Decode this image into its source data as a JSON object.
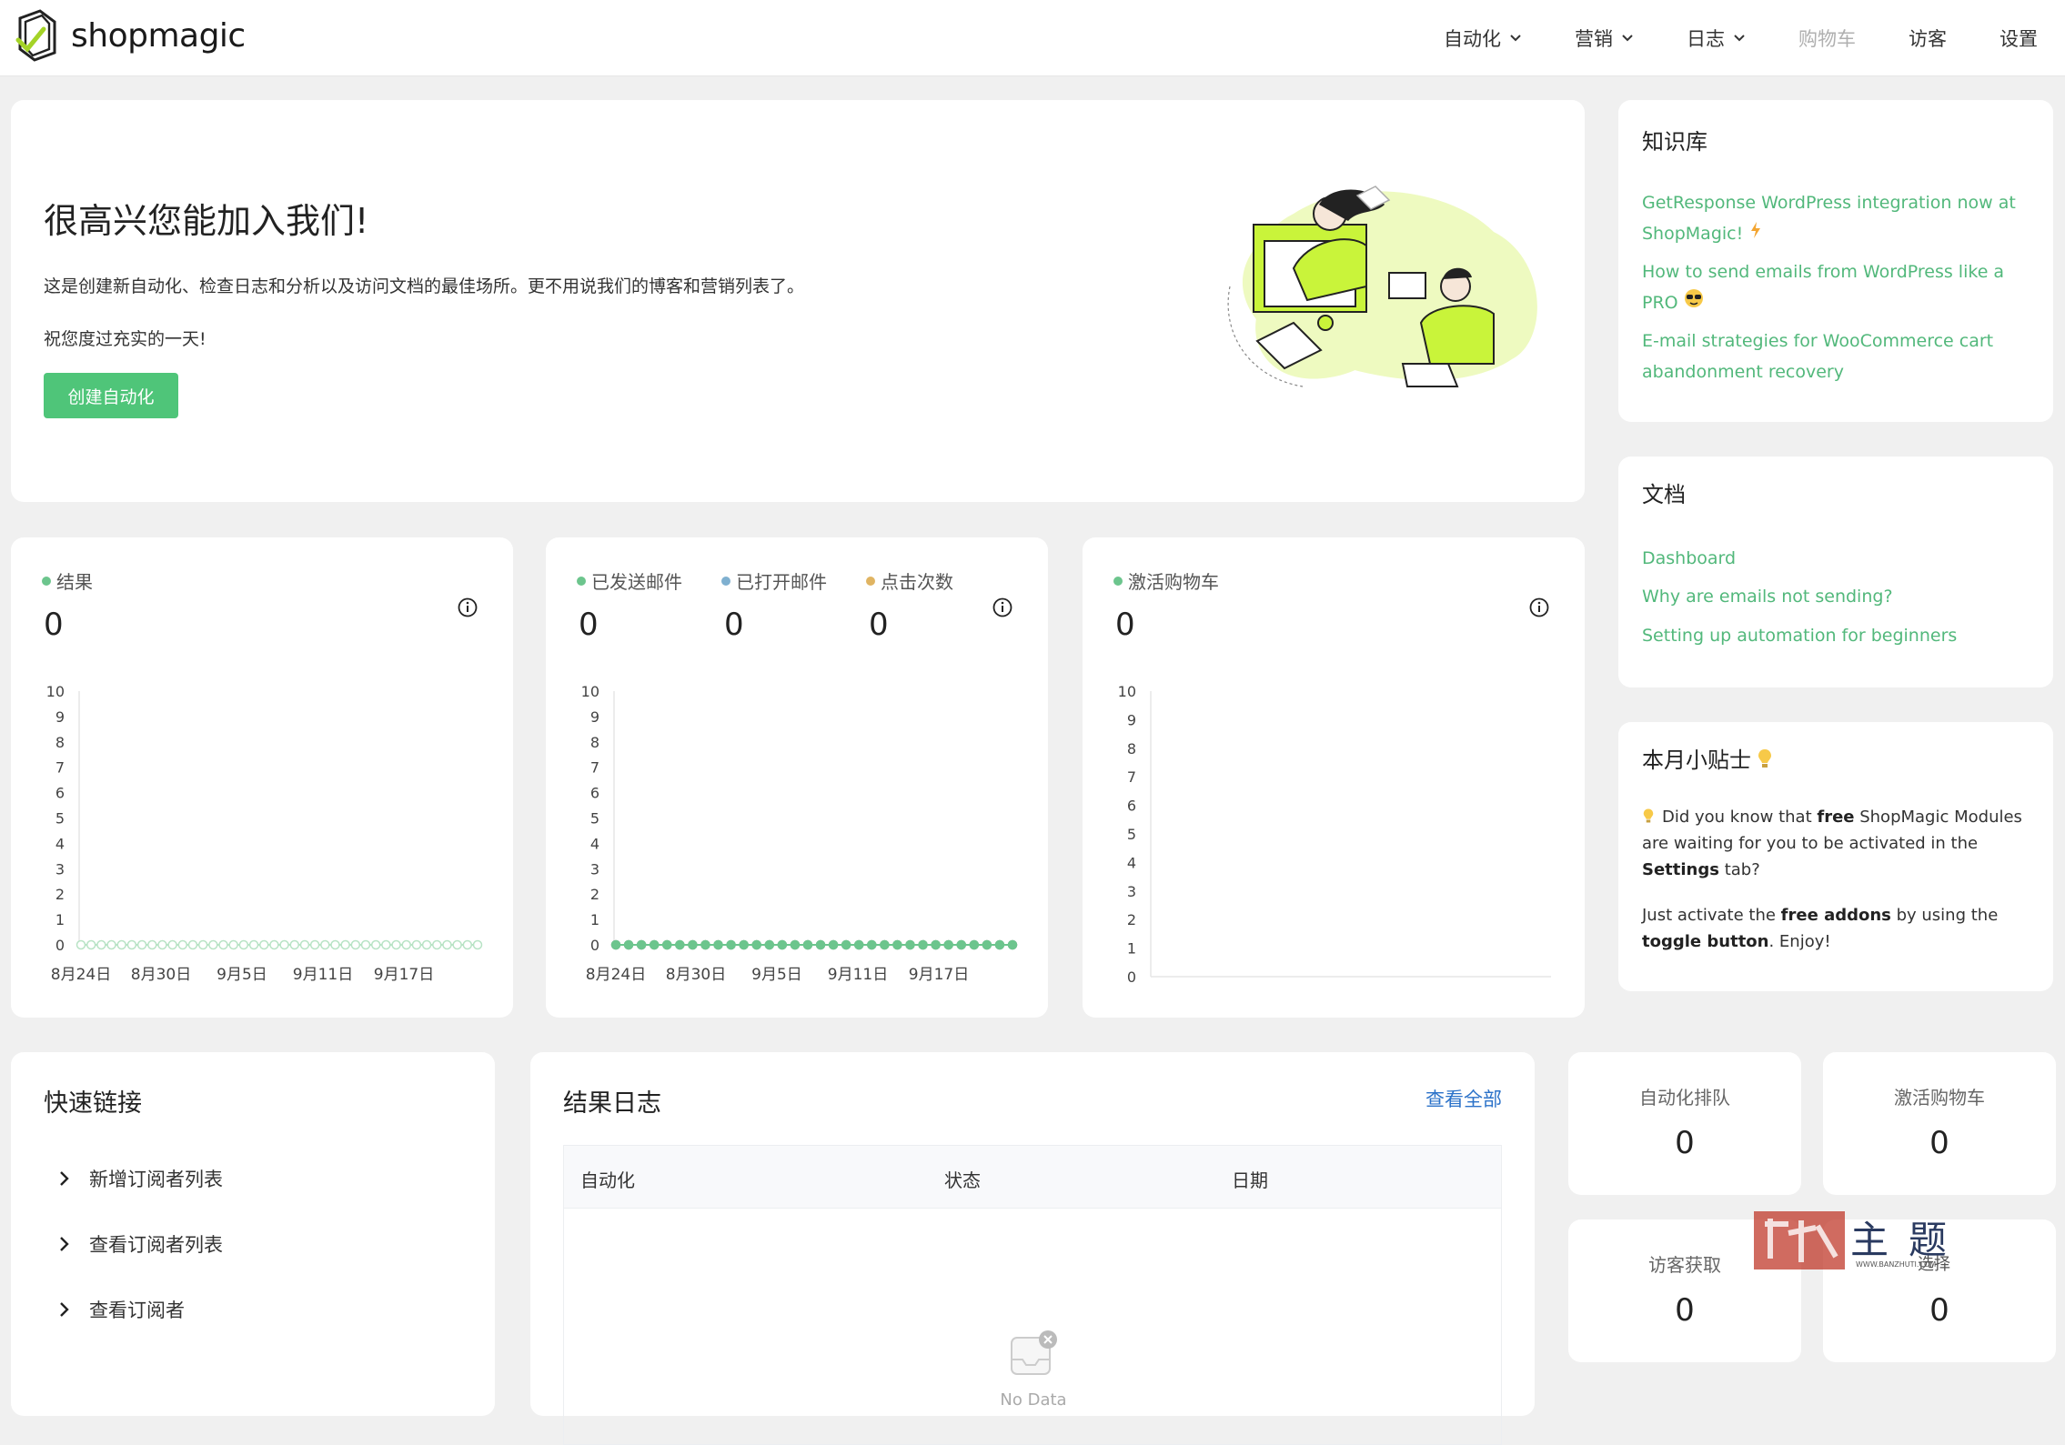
{
  "app": {
    "logo_text": "shopmagic"
  },
  "nav": [
    {
      "label": "自动化",
      "has_dropdown": true,
      "disabled": false
    },
    {
      "label": "营销",
      "has_dropdown": true,
      "disabled": false
    },
    {
      "label": "日志",
      "has_dropdown": true,
      "disabled": false
    },
    {
      "label": "购物车",
      "has_dropdown": false,
      "disabled": true
    },
    {
      "label": "访客",
      "has_dropdown": false,
      "disabled": false
    },
    {
      "label": "设置",
      "has_dropdown": false,
      "disabled": false
    }
  ],
  "welcome": {
    "title": "很高兴您能加入我们!",
    "text1": "这是创建新自动化、检查日志和分析以及访问文档的最佳场所。更不用说我们的博客和营销列表了。",
    "text2": "祝您度过充实的一天!",
    "button": "创建自动化"
  },
  "knowledge": {
    "title": "知识库",
    "links": [
      "GetResponse WordPress integration now at ShopMagic!",
      "How to send emails from WordPress like a PRO",
      "E-mail strategies for WooCommerce cart abandonment recovery"
    ]
  },
  "docs": {
    "title": "文档",
    "links": [
      "Dashboard",
      "Why are emails not sending?",
      "Setting up automation for beginners"
    ]
  },
  "tips": {
    "title": "本月小贴士",
    "p1": {
      "a": "Did you know that ",
      "b": "free",
      "c": " ShopMagic Modules are waiting for you to be activated in the ",
      "d": "Settings",
      "e": " tab?"
    },
    "p2": {
      "a": "Just activate the ",
      "b": "free addons",
      "c": " by using the ",
      "d": "toggle button",
      "e": ". Enjoy!"
    }
  },
  "charts": {
    "results": {
      "legend": [
        "结果"
      ],
      "values": [
        "0"
      ]
    },
    "emails": {
      "legend": [
        "已发送邮件",
        "已打开邮件",
        "点击次数"
      ],
      "values": [
        "0",
        "0",
        "0"
      ]
    },
    "carts": {
      "legend": [
        "激活购物车"
      ],
      "values": [
        "0"
      ]
    }
  },
  "chart_data": [
    {
      "type": "line",
      "series": [
        {
          "name": "结果",
          "color": "#b8e3c5",
          "y": [
            0,
            0,
            0,
            0,
            0,
            0,
            0,
            0,
            0,
            0,
            0,
            0,
            0,
            0,
            0,
            0,
            0,
            0,
            0,
            0,
            0,
            0,
            0,
            0,
            0,
            0,
            0,
            0,
            0,
            0,
            0,
            0,
            0,
            0,
            0,
            0,
            0,
            0,
            0,
            0
          ]
        }
      ],
      "x_tick_labels": [
        "8月24日",
        "8月30日",
        "9月5日",
        "9月11日",
        "9月17日"
      ],
      "y_tick_labels": [
        "0",
        "1",
        "2",
        "3",
        "4",
        "5",
        "6",
        "7",
        "8",
        "9",
        "10"
      ],
      "ylim": [
        0,
        10
      ]
    },
    {
      "type": "line",
      "series": [
        {
          "name": "已发送邮件",
          "color": "#6cc58d",
          "y": [
            0,
            0,
            0,
            0,
            0,
            0,
            0,
            0,
            0,
            0,
            0,
            0,
            0,
            0,
            0,
            0,
            0,
            0,
            0,
            0,
            0,
            0,
            0,
            0,
            0,
            0,
            0,
            0,
            0,
            0,
            0,
            0
          ]
        },
        {
          "name": "已打开邮件",
          "color": "#7fb0d0",
          "y": [
            0,
            0,
            0,
            0,
            0,
            0,
            0,
            0,
            0,
            0,
            0,
            0,
            0,
            0,
            0,
            0,
            0,
            0,
            0,
            0,
            0,
            0,
            0,
            0,
            0,
            0,
            0,
            0,
            0,
            0,
            0,
            0
          ]
        },
        {
          "name": "点击次数",
          "color": "#e0b462",
          "y": [
            0,
            0,
            0,
            0,
            0,
            0,
            0,
            0,
            0,
            0,
            0,
            0,
            0,
            0,
            0,
            0,
            0,
            0,
            0,
            0,
            0,
            0,
            0,
            0,
            0,
            0,
            0,
            0,
            0,
            0,
            0,
            0
          ]
        }
      ],
      "x_tick_labels": [
        "8月24日",
        "8月30日",
        "9月5日",
        "9月11日",
        "9月17日"
      ],
      "y_tick_labels": [
        "0",
        "1",
        "2",
        "3",
        "4",
        "5",
        "6",
        "7",
        "8",
        "9",
        "10"
      ],
      "ylim": [
        0,
        10
      ]
    },
    {
      "type": "line",
      "series": [
        {
          "name": "激活购物车",
          "color": "#6cc58d",
          "y": []
        }
      ],
      "x_tick_labels": [],
      "y_tick_labels": [
        "0",
        "1",
        "2",
        "3",
        "4",
        "5",
        "6",
        "7",
        "8",
        "9",
        "10"
      ],
      "ylim": [
        0,
        10
      ]
    }
  ],
  "quick_links": {
    "title": "快速链接",
    "items": [
      "新增订阅者列表",
      "查看订阅者列表",
      "查看订阅者"
    ]
  },
  "log": {
    "title": "结果日志",
    "view_all": "查看全部",
    "columns": [
      "自动化",
      "状态",
      "日期"
    ],
    "empty": "No Data"
  },
  "stats": [
    {
      "label": "自动化排队",
      "value": "0"
    },
    {
      "label": "激活购物车",
      "value": "0"
    },
    {
      "label": "访客获取",
      "value": "0"
    },
    {
      "label": "",
      "value": "0"
    }
  ],
  "watermark": {
    "text": "主题",
    "sub": "WWW.BANZHUTI.COM",
    "extra": "选择"
  }
}
